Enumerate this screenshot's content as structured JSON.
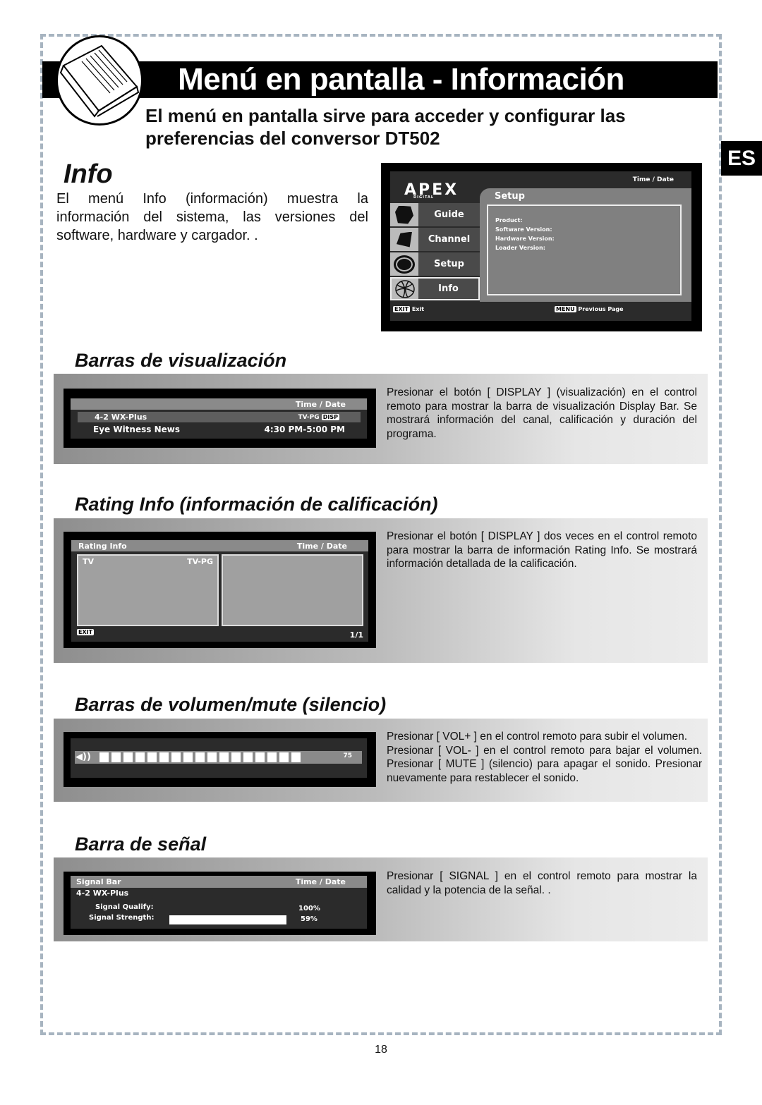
{
  "header": {
    "title": "Menú en pantalla - Información",
    "subtitle": "El menú en pantalla sirve para acceder y configurar las preferencias del conversor DT502",
    "language_tab": "ES"
  },
  "info": {
    "heading": "Info",
    "text": "El menú Info (información) muestra la información del sistema, las versiones del software, hardware y cargador. .",
    "screen": {
      "brand": "APEX",
      "brand_sub": "DIGITAL",
      "time_date": "Time / Date",
      "panel_title": "Setup",
      "menu": [
        {
          "label": "Guide",
          "icon": "hexagon-icon"
        },
        {
          "label": "Channel",
          "icon": "quad-icon"
        },
        {
          "label": "Setup",
          "icon": "ring-icon"
        },
        {
          "label": "Info",
          "icon": "globe-icon",
          "selected": true
        }
      ],
      "fields": [
        "Product:",
        "Software Version:",
        "Hardware Version:",
        "Loader Version:"
      ],
      "exit_key": "EXIT",
      "exit_label": "Exit",
      "menu_key": "MENU",
      "menu_label": "Previous Page"
    }
  },
  "display_bar": {
    "heading": "Barras de visualización",
    "text": "Presionar el botón [ DISPLAY ] (visualización) en el control remoto para mostrar la barra de visualización Display Bar. Se mostrará información del canal, calificación y duración del programa.",
    "screen": {
      "time_date": "Time / Date",
      "channel": "4-2 WX-Plus",
      "rating": "TV-PG",
      "disp_key": "DISP",
      "program": "Eye Witness News",
      "time": "4:30 PM-5:00 PM"
    }
  },
  "rating_info": {
    "heading": "Rating Info (información de calificación)",
    "text": "Presionar el botón [ DISPLAY ] dos veces en el control remoto para mostrar la barra de información Rating Info. Se mostrará información detallada de la calificación.",
    "screen": {
      "title": "Rating Info",
      "time_date": "Time / Date",
      "tv": "TV",
      "rating": "TV-PG",
      "exit_key": "EXIT",
      "page": "1/1"
    }
  },
  "volume": {
    "heading": "Barras de volumen/mute (silencio)",
    "text": "Presionar [ VOL+ ] en el control remoto para subir el volumen.\nPresionar [ VOL- ] en el control remoto para bajar el volumen. Presionar [ MUTE ] (silencio) para apagar el sonido. Presionar nuevamente para restablecer el sonido.",
    "screen": {
      "value": "75",
      "filled_blocks": 17
    }
  },
  "signal": {
    "heading": "Barra de señal",
    "text": "Presionar [ SIGNAL ] en el control remoto para mostrar la calidad y la potencia de la señal. .",
    "screen": {
      "title": "Signal Bar",
      "time_date": "Time / Date",
      "channel": "4-2 WX-Plus",
      "quality_label": "Signal Qualify:",
      "quality_value": "100%",
      "strength_label": "Signal Strength:",
      "strength_value": "59%"
    }
  },
  "page_number": "18"
}
